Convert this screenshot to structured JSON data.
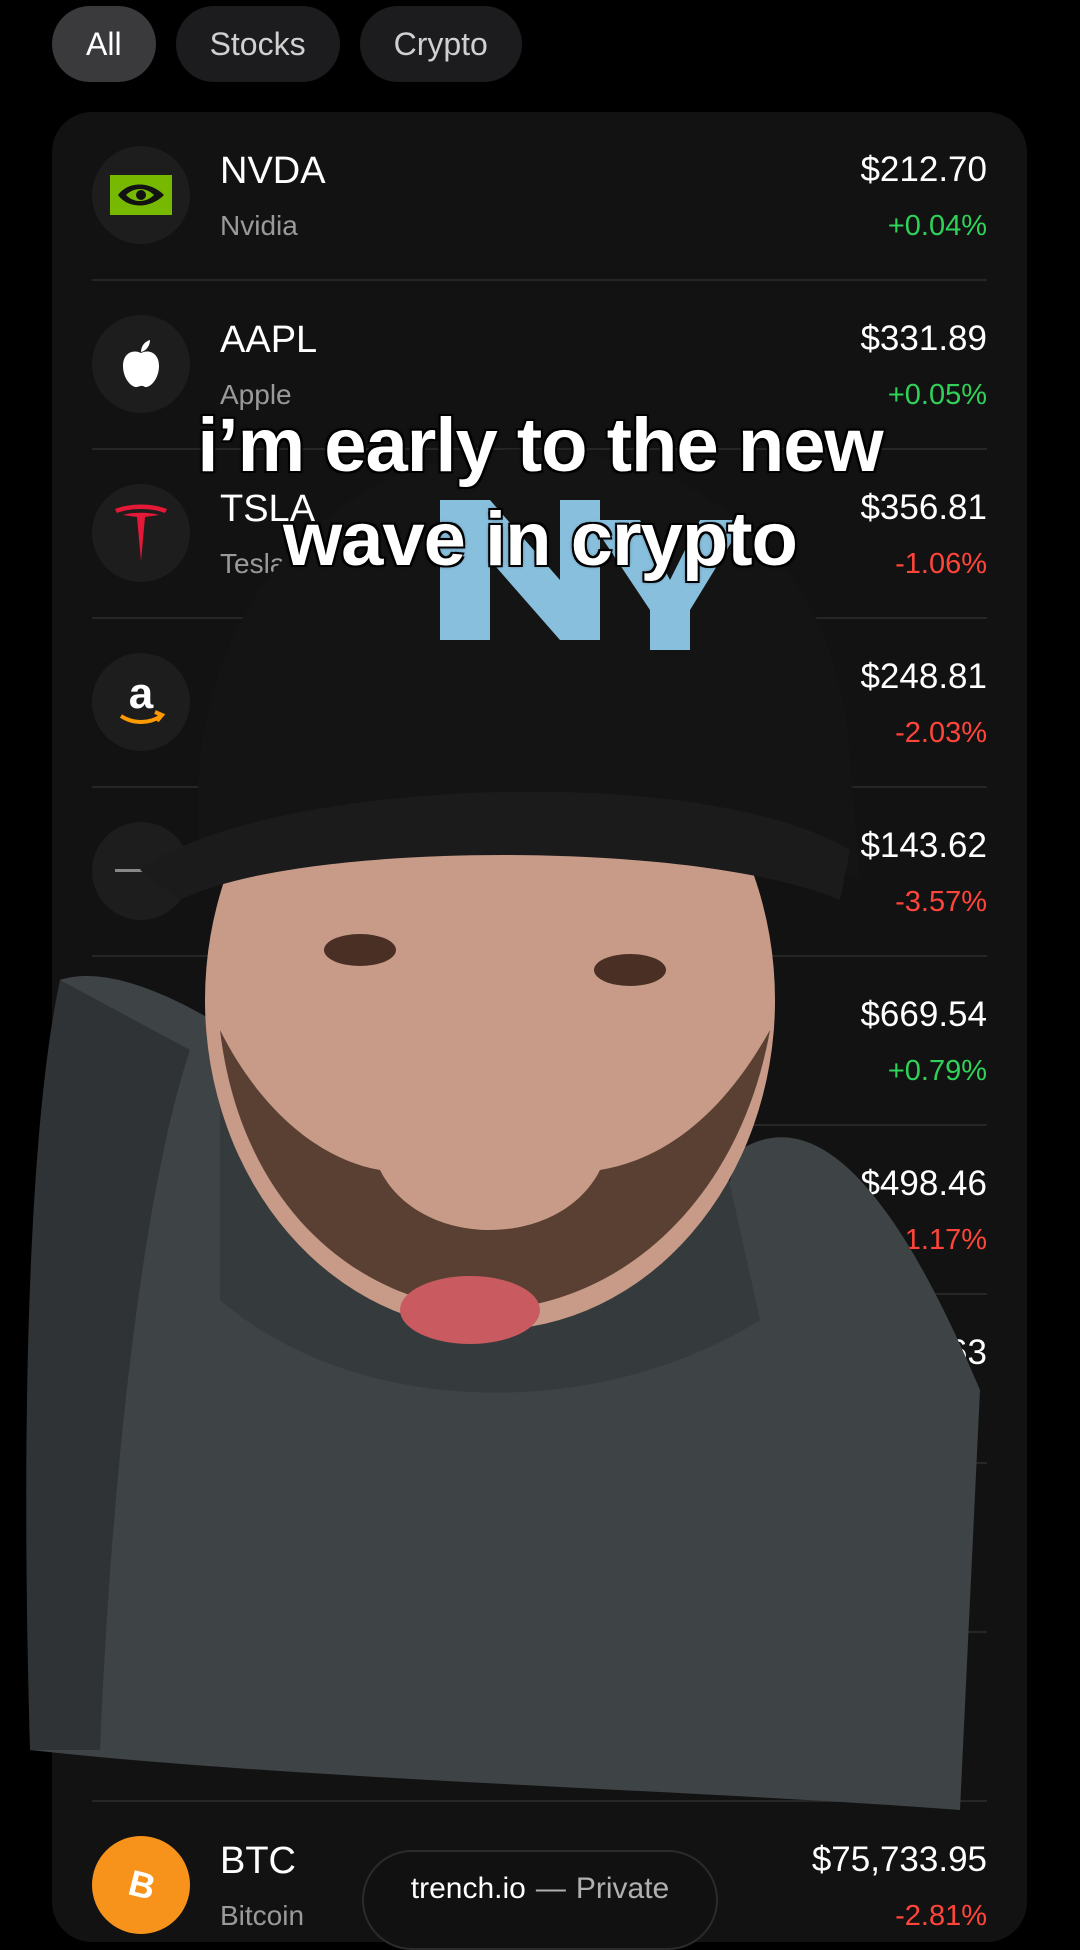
{
  "filters": {
    "all": "All",
    "stocks": "Stocks",
    "crypto": "Crypto"
  },
  "rows": [
    {
      "ticker": "NVDA",
      "name": "Nvidia",
      "price": "$212.70",
      "change": "+0.04%",
      "direction": "up",
      "icon": "nvidia-logo"
    },
    {
      "ticker": "AAPL",
      "name": "Apple",
      "price": "$331.89",
      "change": "+0.05%",
      "direction": "up",
      "icon": "apple-logo"
    },
    {
      "ticker": "TSLA",
      "name": "Tesla",
      "price": "$356.81",
      "change": "-1.06%",
      "direction": "down",
      "icon": "tesla-logo"
    },
    {
      "ticker": "",
      "name": "",
      "price": "$248.81",
      "change": "-2.03%",
      "direction": "down",
      "icon": "amazon-logo"
    },
    {
      "ticker": "",
      "name": "",
      "price": "$143.62",
      "change": "-3.57%",
      "direction": "down",
      "icon": "spacex-logo"
    },
    {
      "ticker": "",
      "name": "",
      "price": "$669.54",
      "change": "+0.79%",
      "direction": "up",
      "icon": ""
    },
    {
      "ticker": "",
      "name": "",
      "price": "$498.46",
      "change": "-1.17%",
      "direction": "down",
      "icon": ""
    },
    {
      "ticker": "",
      "name": "",
      "price": "$171.63",
      "change": "",
      "direction": "down",
      "icon": ""
    },
    {
      "ticker": "",
      "name": "",
      "price": "",
      "change": "",
      "direction": "down",
      "icon": ""
    },
    {
      "ticker": "",
      "name": "",
      "price": "",
      "change": "",
      "direction": "down",
      "icon": ""
    }
  ],
  "btc": {
    "ticker": "BTC",
    "name": "Bitcoin",
    "price": "$75,733.95",
    "change": "-2.81%",
    "icon": "bitcoin-logo"
  },
  "caption": {
    "line1": "i’m early to the new",
    "line2": "wave in crypto"
  },
  "footer_pill": {
    "site": "trench.io",
    "separator": "—",
    "label": "Private"
  },
  "colors": {
    "up": "#30d158",
    "down": "#ff453a",
    "card": "#121212"
  }
}
